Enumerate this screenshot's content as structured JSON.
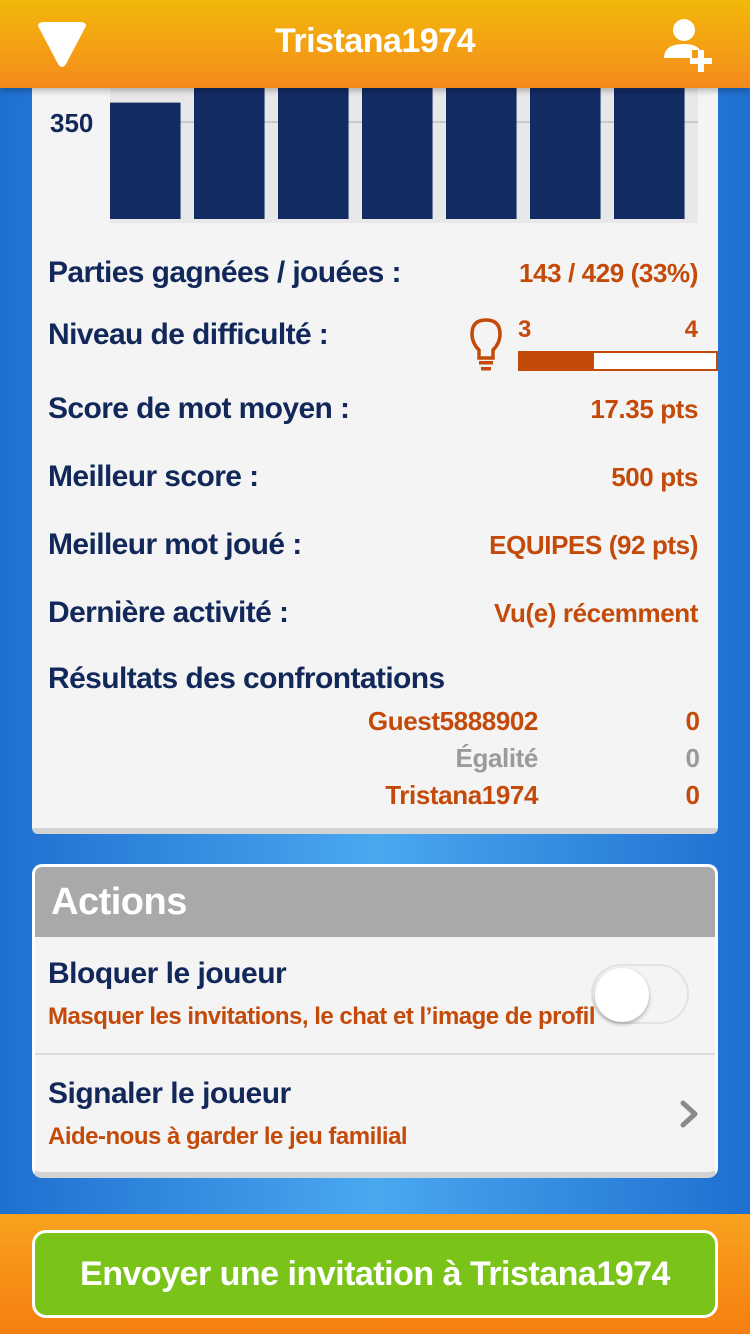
{
  "header": {
    "title": "Tristana1974",
    "menu_icon": "triangle-menu-icon",
    "add_friend_icon": "add-user-icon"
  },
  "chart_data": {
    "type": "bar",
    "categories": [
      "",
      "",
      "",
      "",
      "",
      "",
      ""
    ],
    "values": [
      370,
      430,
      410,
      427,
      390,
      407,
      385
    ],
    "ylim": [
      250,
      450
    ],
    "yticks": [
      350
    ],
    "bar_color": "#122b63",
    "grid": true
  },
  "stats": {
    "games": {
      "label": "Parties gagnées / jouées :",
      "value": "143 / 429 (33%)"
    },
    "difficulty": {
      "label": "Niveau de difficulté :",
      "low": "3",
      "high": "4",
      "progress": 0.38
    },
    "avg_word": {
      "label": "Score de mot moyen :",
      "value": "17.35 pts"
    },
    "best_score": {
      "label": "Meilleur score :",
      "value": "500 pts"
    },
    "best_word": {
      "label": "Meilleur mot joué :",
      "value": "EQUIPES (92 pts)"
    },
    "last_activity": {
      "label": "Dernière activité :",
      "value": "Vu(e) récemment"
    }
  },
  "head_to_head": {
    "title": "Résultats des confrontations",
    "rows": [
      {
        "name": "Guest5888902",
        "value": "0"
      },
      {
        "name": "Égalité",
        "value": "0"
      },
      {
        "name": "Tristana1974",
        "value": "0"
      }
    ]
  },
  "actions": {
    "title": "Actions",
    "block": {
      "title": "Bloquer le joueur",
      "subtitle": "Masquer les invitations, le chat et l’image de profil",
      "enabled": false
    },
    "report": {
      "title": "Signaler le joueur",
      "subtitle": "Aide-nous à garder le jeu familial"
    }
  },
  "footer": {
    "invite_label": "Envoyer une invitation à Tristana1974",
    "button_color": "#7ac41a"
  },
  "colors": {
    "navy": "#12285a",
    "accent": "#c44a0a",
    "header_top": "#f2b90a",
    "header_bottom": "#f58a1c"
  }
}
